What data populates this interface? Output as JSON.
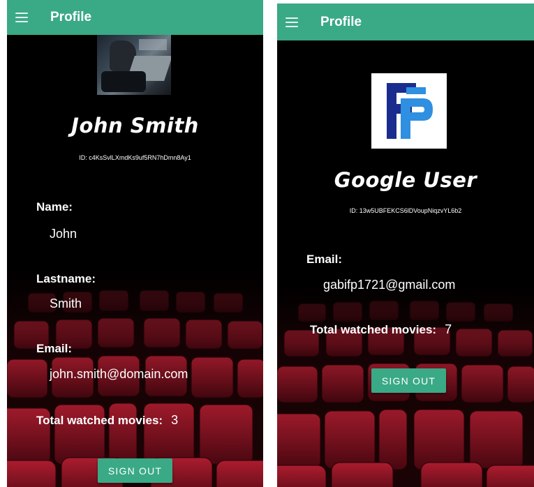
{
  "left": {
    "appbar": {
      "title": "Profile"
    },
    "profile": {
      "display_name": "John Smith",
      "uid": "ID: c4KsSvlLXmdKs9uf5RN7hDmn8Ay1",
      "name_label": "Name:",
      "name_value": "John",
      "lastname_label": "Lastname:",
      "lastname_value": "Smith",
      "email_label": "Email:",
      "email_value": "john.smith@domain.com",
      "movies_label": "Total watched movies:",
      "movies_value": "3"
    },
    "signout_label": "SIGN OUT"
  },
  "right": {
    "appbar": {
      "title": "Profile"
    },
    "profile": {
      "display_name": "Google User",
      "uid": "ID: 13w5UBFEKCS6lDVoupNiqzvYL6b2",
      "email_label": "Email:",
      "email_value": "gabifp1721@gmail.com",
      "movies_label": "Total watched movies:",
      "movies_value": "7"
    },
    "signout_label": "SIGN OUT"
  },
  "colors": {
    "appbar": "#3aa986",
    "button": "#3aa986",
    "background": "#000000",
    "seat": "#8e1525",
    "logo_dark_blue": "#1a2d8f",
    "logo_light_blue": "#2f8fe0"
  },
  "icons": [
    "menu-icon",
    "avatar-photo",
    "fp-logo-icon",
    "cinema-seats-background"
  ]
}
